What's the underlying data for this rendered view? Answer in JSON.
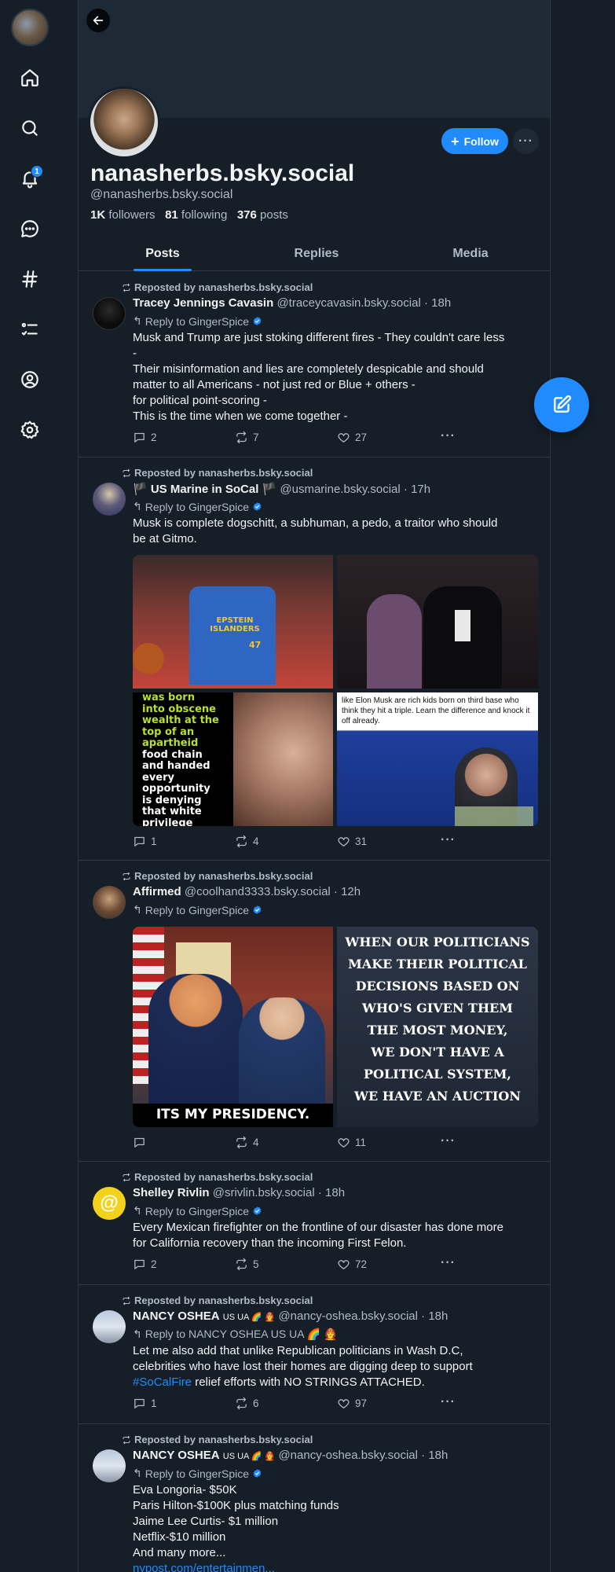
{
  "profile": {
    "display_name": "nanasherbs.bsky.social",
    "handle": "@nanasherbs.bsky.social",
    "followers_count": "1K",
    "followers_label": "followers",
    "following_count": "81",
    "following_label": "following",
    "posts_count": "376",
    "posts_label": "posts",
    "follow_label": "Follow",
    "more_label": "···"
  },
  "nav": {
    "notifications_badge": "1"
  },
  "tabs": [
    {
      "label": "Posts",
      "active": true
    },
    {
      "label": "Replies",
      "active": false
    },
    {
      "label": "Media",
      "active": false
    }
  ],
  "posts": [
    {
      "repost_by": "Reposted by nanasherbs.bsky.social",
      "author": "Tracey Jennings Cavasin",
      "handle": "@traceycavasin.bsky.social",
      "time": "18h",
      "reply_to": "Reply to GingerSpice",
      "text_lines": [
        "Musk and Trump are just stoking different fires - They couldn't care less",
        "-",
        "Their misinformation and lies are completely despicable and should",
        "matter to all Americans - not just red or Blue + others -",
        "for political point-scoring -",
        "This is the time when we come together -"
      ],
      "replies": "2",
      "reposts": "7",
      "likes": "27"
    },
    {
      "repost_by": "Reposted by nanasherbs.bsky.social",
      "author": "🏴 US Marine in SoCal 🏴",
      "handle": "@usmarine.bsky.social",
      "time": "17h",
      "reply_to": "Reply to GingerSpice",
      "text_lines": [
        "Musk is complete dogschitt, a subhuman, a pedo, a traitor who should",
        "be at Gitmo."
      ],
      "image_texts": {
        "jersey": "EPSTEIN ISLANDERS",
        "jersey_number": "47",
        "meme_lines": [
          "was born",
          "into obscene",
          "wealth at the",
          "top of an",
          "apartheid",
          "food chain",
          "and handed",
          "every",
          "opportunity",
          "is denying",
          "that white",
          "privilege"
        ],
        "quote": "like Elon Musk are rich kids born on third base who think they hit a triple. Learn the difference and knock it off already."
      },
      "replies": "1",
      "reposts": "4",
      "likes": "31"
    },
    {
      "repost_by": "Reposted by nanasherbs.bsky.social",
      "author": "Affirmed",
      "handle": "@coolhand3333.bsky.social",
      "time": "12h",
      "reply_to": "Reply to GingerSpice",
      "image_texts": {
        "caption_left": "ITS MY PRESIDENCY.",
        "caption_right_lines": [
          "WHEN OUR POLITICIANS",
          "MAKE THEIR POLITICAL",
          "DECISIONS BASED ON",
          "WHO'S GIVEN THEM",
          "THE MOST MONEY,",
          "WE DON'T HAVE A",
          "POLITICAL SYSTEM,",
          "WE HAVE AN AUCTION"
        ]
      },
      "replies": "",
      "reposts": "4",
      "likes": "11"
    },
    {
      "repost_by": "Reposted by nanasherbs.bsky.social",
      "author": "Shelley Rivlin",
      "handle": "@srivlin.bsky.social",
      "time": "18h",
      "reply_to": "Reply to GingerSpice",
      "text_lines": [
        "Every Mexican firefighter on the frontline of our disaster has done more",
        "for California recovery than the incoming First Felon."
      ],
      "replies": "2",
      "reposts": "5",
      "likes": "72"
    },
    {
      "repost_by": "Reposted by nanasherbs.bsky.social",
      "author": "NANCY OSHEA",
      "author_suffix": "US UA 🌈 🧑‍🚒",
      "handle": "@nancy-oshea.bsky.social",
      "time": "18h",
      "reply_to": "Reply to NANCY OSHEA US UA 🌈 🧑‍🚒",
      "text_lines": [
        "Let me also add that unlike Republican politicians in Wash D.C,",
        "celebrities who have lost their homes are digging deep to support"
      ],
      "hashtag": "#SoCalFire",
      "text_after_hashtag": " relief efforts with NO STRINGS ATTACHED.",
      "replies": "1",
      "reposts": "6",
      "likes": "97"
    },
    {
      "repost_by": "Reposted by nanasherbs.bsky.social",
      "author": "NANCY OSHEA",
      "author_suffix": "US UA 🌈 🧑‍🚒",
      "handle": "@nancy-oshea.bsky.social",
      "time": "18h",
      "reply_to": "Reply to GingerSpice",
      "text_lines": [
        "Eva Longoria- $50K",
        "Paris Hilton-$100K plus matching funds",
        "Jaime Lee Curtis- $1 million",
        "Netflix-$10 million",
        "And many more..."
      ],
      "link": "nypost.com/entertainmen..."
    }
  ],
  "colors": {
    "background": "#161e27",
    "accent": "#208bfe",
    "text_primary": "#f1f3f5",
    "text_secondary": "#aebbc9",
    "border": "#2e3a47"
  }
}
